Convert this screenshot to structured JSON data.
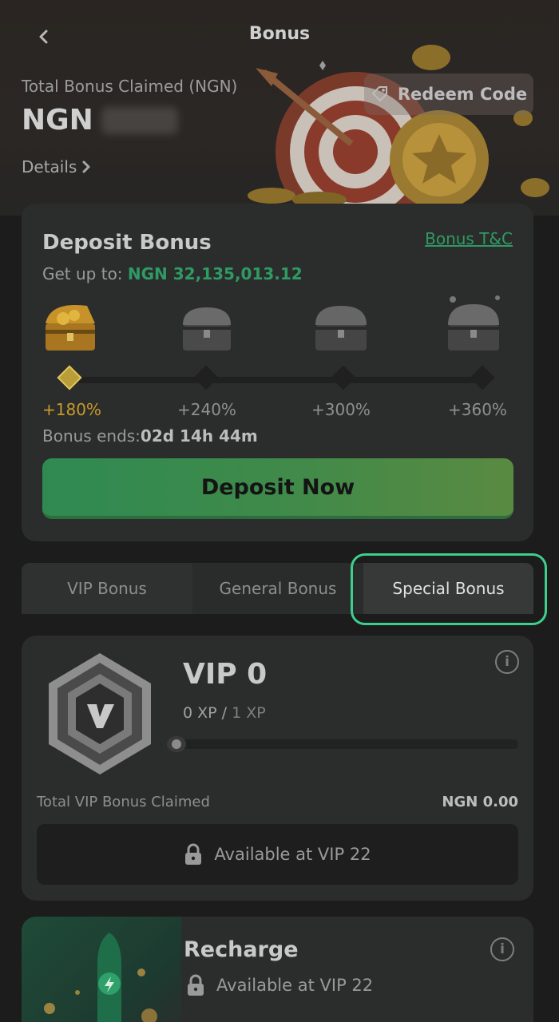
{
  "header": {
    "title": "Bonus",
    "total_label": "Total Bonus Claimed (NGN)",
    "total_currency": "NGN",
    "details_label": "Details",
    "redeem_label": "Redeem Code"
  },
  "deposit": {
    "title": "Deposit Bonus",
    "tc_label": "Bonus T&C",
    "getup_prefix": "Get up to:",
    "getup_amount": "NGN 32,135,013.12",
    "tiers": [
      "+180%",
      "+240%",
      "+300%",
      "+360%"
    ],
    "active_tier": 0,
    "ends_prefix": "Bonus ends:",
    "ends_time": "02d 14h 44m",
    "button_label": "Deposit Now"
  },
  "tabs": {
    "items": [
      "VIP Bonus",
      "General Bonus",
      "Special Bonus"
    ],
    "active": "Special Bonus"
  },
  "vip": {
    "level": "VIP 0",
    "xp_current": "0 XP /",
    "xp_required": "1 XP",
    "progress": 0,
    "claimed_label": "Total VIP Bonus Claimed",
    "claimed_value": "NGN 0.00",
    "locked_label": "Available at VIP 22"
  },
  "recharge": {
    "title": "Recharge",
    "locked_label": "Available at VIP 22"
  },
  "colors": {
    "accent_green": "#2f9a63",
    "gold": "#c99a2a",
    "highlight_ring": "#3fcf8c"
  }
}
